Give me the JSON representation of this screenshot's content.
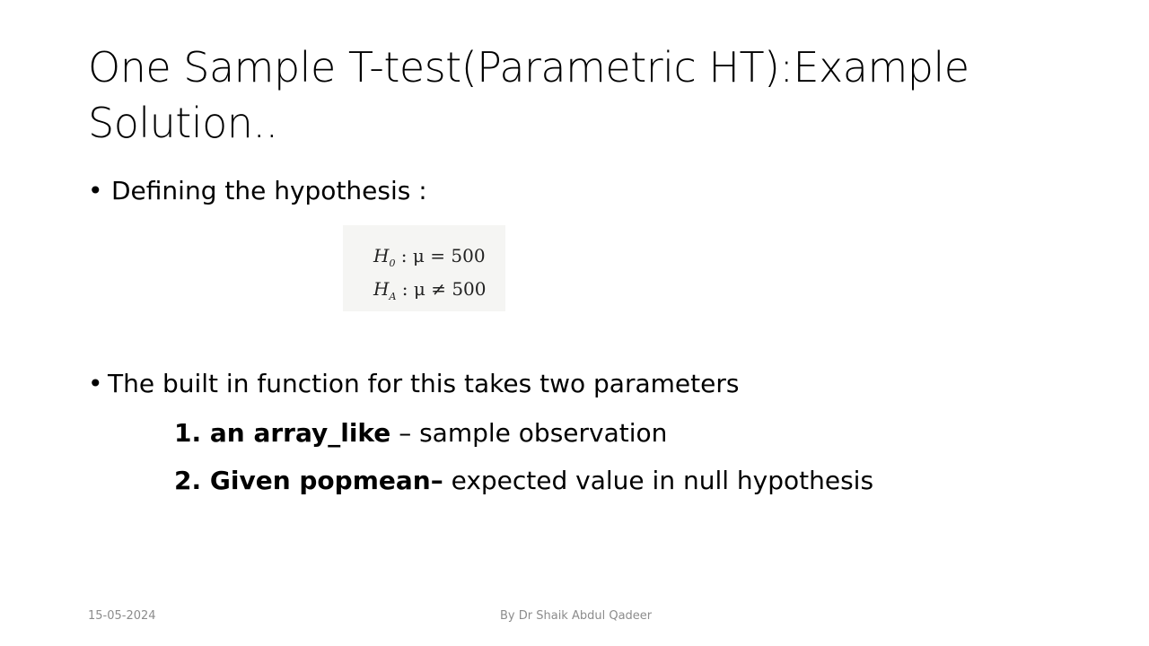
{
  "slide": {
    "title_line1": "One Sample T-test(Parametric HT):Example",
    "title_line2": "Solution..",
    "bullets": [
      {
        "marker": "•",
        "text": "Defining the hypothesis :"
      },
      {
        "marker": "•",
        "text": "The built in function for this takes two parameters"
      }
    ],
    "hypothesis": {
      "h0": {
        "symbol": "H",
        "subscript": "0",
        "rest": " : μ = 500"
      },
      "ha": {
        "symbol": "H",
        "subscript": "A",
        "rest": " : μ ≠ 500"
      }
    },
    "params": [
      {
        "bold": "1. an array_like",
        "text": " – sample observation"
      },
      {
        "bold": "2. Given popmean–",
        "text": " expected value in null hypothesis"
      }
    ],
    "footer": {
      "date": "15-05-2024",
      "author": "By Dr Shaik Abdul Qadeer"
    }
  }
}
